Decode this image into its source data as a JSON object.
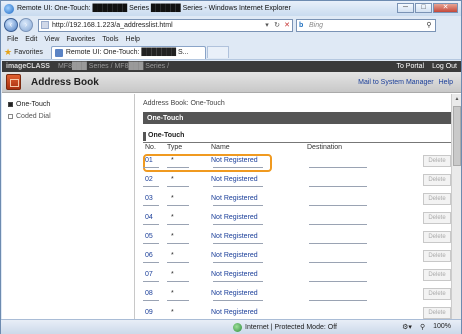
{
  "window": {
    "title": "Remote UI: One-Touch: ███████ Series ██████ Series - Windows Internet Explorer",
    "minimize": "─",
    "restore": "□",
    "close": "✕"
  },
  "address_bar": {
    "url": "http://192.168.1.223/a_addresslist.html",
    "search_placeholder": "Bing"
  },
  "menu": [
    "File",
    "Edit",
    "View",
    "Favorites",
    "Tools",
    "Help"
  ],
  "favorites_bar": {
    "favorites_label": "Favorites",
    "tab_title": "Remote UI: One-Touch: ███████ S..."
  },
  "content_bar": {
    "model": "imageCLASS",
    "series": "MF8███ Series / MF8███ Series /",
    "to_portal": "To Portal",
    "log_out": "Log Out"
  },
  "header": {
    "title": "Address Book",
    "mail_link": "Mail to System Manager",
    "help_link": "Help"
  },
  "sidebar": {
    "items": [
      {
        "label": "One-Touch",
        "active": true
      },
      {
        "label": "Coded Dial",
        "active": false
      }
    ]
  },
  "main": {
    "breadcrumb": "Address Book: One-Touch",
    "page_title": "One-Touch",
    "section_title": "One-Touch",
    "columns": [
      "No.",
      "Type",
      "Name",
      "Destination"
    ],
    "rows": [
      {
        "no": "01",
        "type": "*",
        "name": "Not Registered",
        "delete": "Delete"
      },
      {
        "no": "02",
        "type": "*",
        "name": "Not Registered",
        "delete": "Delete"
      },
      {
        "no": "03",
        "type": "*",
        "name": "Not Registered",
        "delete": "Delete"
      },
      {
        "no": "04",
        "type": "*",
        "name": "Not Registered",
        "delete": "Delete"
      },
      {
        "no": "05",
        "type": "*",
        "name": "Not Registered",
        "delete": "Delete"
      },
      {
        "no": "06",
        "type": "*",
        "name": "Not Registered",
        "delete": "Delete"
      },
      {
        "no": "07",
        "type": "*",
        "name": "Not Registered",
        "delete": "Delete"
      },
      {
        "no": "08",
        "type": "*",
        "name": "Not Registered",
        "delete": "Delete"
      },
      {
        "no": "09",
        "type": "*",
        "name": "Not Registered",
        "delete": "Delete"
      }
    ]
  },
  "status_bar": {
    "zone": "Internet | Protected Mode: Off",
    "zoom": "100%"
  }
}
